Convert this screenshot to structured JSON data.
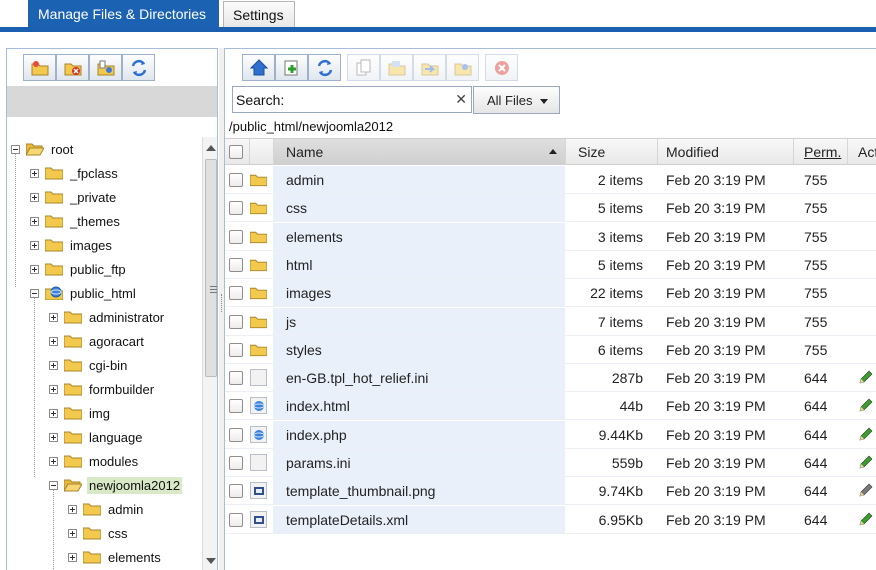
{
  "tabs": {
    "active": "Manage Files & Directories",
    "inactive": "Settings"
  },
  "left_toolbar": [
    "new-folder-icon",
    "delete-folder-icon",
    "folder-properties-icon",
    "refresh-icon"
  ],
  "tree": {
    "nodes": [
      {
        "label": "root",
        "expanded": true
      },
      {
        "label": "_fpclass",
        "expanded": false
      },
      {
        "label": "_private",
        "expanded": false
      },
      {
        "label": "_themes",
        "expanded": false
      },
      {
        "label": "images",
        "expanded": false
      },
      {
        "label": "public_ftp",
        "expanded": false
      },
      {
        "label": "public_html",
        "expanded": true
      },
      {
        "label": "administrator",
        "expanded": false
      },
      {
        "label": "agoracart",
        "expanded": false
      },
      {
        "label": "cgi-bin",
        "expanded": false
      },
      {
        "label": "formbuilder",
        "expanded": false
      },
      {
        "label": "img",
        "expanded": false
      },
      {
        "label": "language",
        "expanded": false
      },
      {
        "label": "modules",
        "expanded": false
      },
      {
        "label": "newjoomla2012",
        "expanded": true,
        "selected": true
      },
      {
        "label": "admin",
        "expanded": false
      },
      {
        "label": "css",
        "expanded": false
      },
      {
        "label": "elements",
        "expanded": false
      }
    ]
  },
  "right_toolbar": [
    "home-icon",
    "new-file-icon",
    "refresh-icon",
    "copy-icon",
    "upload-icon",
    "move-icon",
    "rename-icon",
    "delete-icon"
  ],
  "search": {
    "value": "Search:",
    "clear": "✕"
  },
  "filter": {
    "selected": "All Files"
  },
  "breadcrumb": "/public_html/newjoomla2012",
  "table": {
    "headers": {
      "name": "Name",
      "size": "Size",
      "modified": "Modified",
      "perm": "Perm.",
      "actions": "Act"
    },
    "rows": [
      {
        "name": "admin",
        "size": "2 items",
        "modified": "Feb 20 3:19 PM",
        "perm": "755",
        "type": "folder"
      },
      {
        "name": "css",
        "size": "5 items",
        "modified": "Feb 20 3:19 PM",
        "perm": "755",
        "type": "folder"
      },
      {
        "name": "elements",
        "size": "3 items",
        "modified": "Feb 20 3:19 PM",
        "perm": "755",
        "type": "folder"
      },
      {
        "name": "html",
        "size": "5 items",
        "modified": "Feb 20 3:19 PM",
        "perm": "755",
        "type": "folder"
      },
      {
        "name": "images",
        "size": "22 items",
        "modified": "Feb 20 3:19 PM",
        "perm": "755",
        "type": "folder"
      },
      {
        "name": "js",
        "size": "7 items",
        "modified": "Feb 20 3:19 PM",
        "perm": "755",
        "type": "folder"
      },
      {
        "name": "styles",
        "size": "6 items",
        "modified": "Feb 20 3:19 PM",
        "perm": "755",
        "type": "folder"
      },
      {
        "name": "en-GB.tpl_hot_relief.ini",
        "size": "287b",
        "modified": "Feb 20 3:19 PM",
        "perm": "644",
        "type": "file",
        "editable": true
      },
      {
        "name": "index.html",
        "size": "44b",
        "modified": "Feb 20 3:19 PM",
        "perm": "644",
        "type": "web",
        "editable": true
      },
      {
        "name": "index.php",
        "size": "9.44Kb",
        "modified": "Feb 20 3:19 PM",
        "perm": "644",
        "type": "web",
        "editable": true
      },
      {
        "name": "params.ini",
        "size": "559b",
        "modified": "Feb 20 3:19 PM",
        "perm": "644",
        "type": "file",
        "editable": true
      },
      {
        "name": "template_thumbnail.png",
        "size": "9.74Kb",
        "modified": "Feb 20 3:19 PM",
        "perm": "644",
        "type": "image",
        "editable": false
      },
      {
        "name": "templateDetails.xml",
        "size": "6.95Kb",
        "modified": "Feb 20 3:19 PM",
        "perm": "644",
        "type": "image",
        "editable": true
      }
    ]
  },
  "colors": {
    "accent": "#1c62b3",
    "row_highlight": "#e9f0fa",
    "selected_tree": "#d9e8c6",
    "folder": "#f2c94c"
  }
}
